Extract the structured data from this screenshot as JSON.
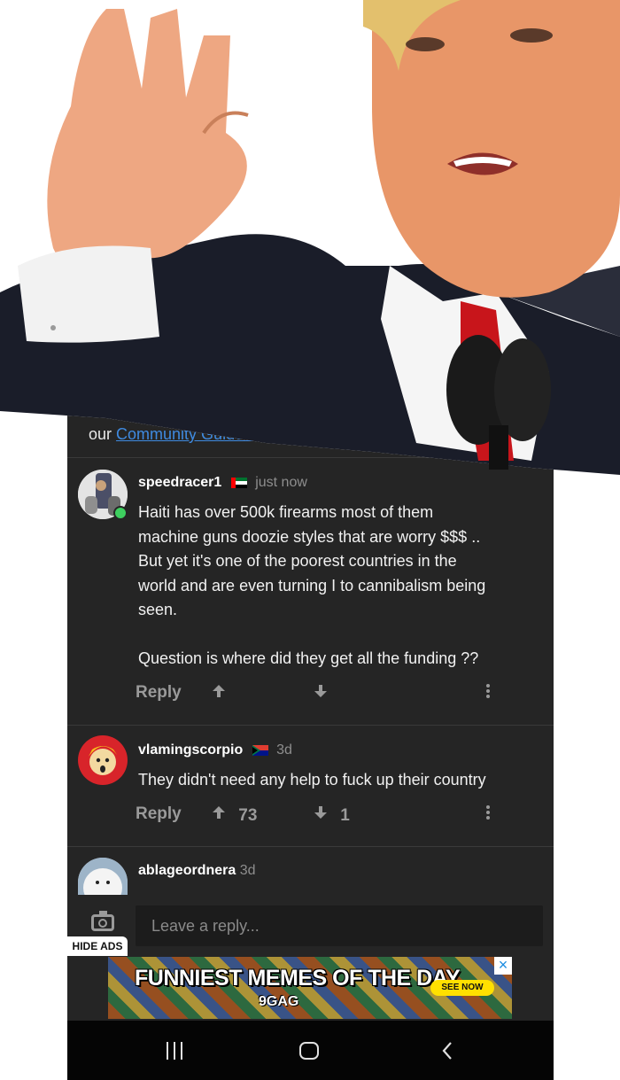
{
  "community": {
    "prefix": "our",
    "link": "Community Guidelines."
  },
  "comments": [
    {
      "username": "speedracer1",
      "time": "just now",
      "text_lines": [
        "Haiti has over 500k  firearms most of them",
        "machine guns doozie styles that are worry $$$ ..",
        "But yet it's one of the poorest countries in the",
        "world and are even turning I to cannibalism being",
        "seen."
      ],
      "text_line_extra": "Question is where did they get all the funding ??",
      "reply_label": "Reply",
      "upvotes": "",
      "downvotes": ""
    },
    {
      "username": "vlamingscorpio",
      "time": "3d",
      "text_lines": [
        "They didn't need any help to fuck up their country"
      ],
      "reply_label": "Reply",
      "upvotes": "73",
      "downvotes": "1"
    },
    {
      "username": "ablageordnera",
      "time": "3d"
    }
  ],
  "reply_box": {
    "placeholder": "Leave a reply..."
  },
  "ads": {
    "hide_label": "HIDE ADS",
    "title": "FUNNIEST MEMES OF THE DAY",
    "brand": "9GAG",
    "cta": "SEE NOW",
    "close": "×"
  },
  "icons": {
    "image": "image-icon",
    "upvote": "arrow-up-icon",
    "downvote": "arrow-down-icon",
    "more": "more-vertical-icon",
    "camera": "camera-icon",
    "nav_recent": "recent-apps-icon",
    "nav_home": "home-icon",
    "nav_back": "back-icon"
  },
  "colors": {
    "link": "#3f8ae0",
    "online": "#3ecf5f",
    "background": "#252525"
  }
}
